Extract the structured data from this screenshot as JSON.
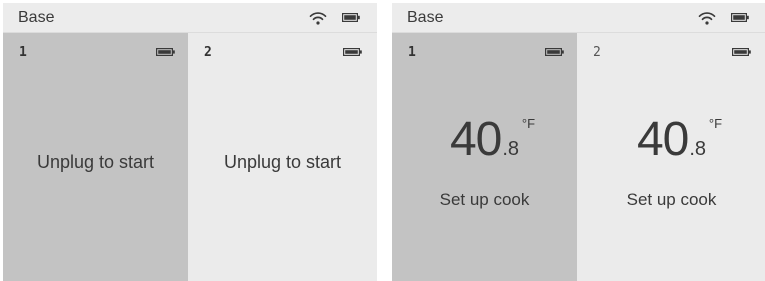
{
  "screens": [
    {
      "title": "Base",
      "status_icons": [
        "wifi-icon",
        "battery-icon"
      ],
      "probes": [
        {
          "number": "1",
          "battery_icon": "battery-icon",
          "selected": true,
          "message": "Unplug to start"
        },
        {
          "number": "2",
          "battery_icon": "battery-icon",
          "selected": false,
          "message": "Unplug to start"
        }
      ]
    },
    {
      "title": "Base",
      "status_icons": [
        "wifi-icon",
        "battery-icon"
      ],
      "probes": [
        {
          "number": "1",
          "battery_icon": "battery-icon",
          "selected": true,
          "temp_whole": "40",
          "temp_decimal": ".8",
          "temp_unit": "°F",
          "message": "Set up cook"
        },
        {
          "number": "2",
          "battery_icon": "battery-icon",
          "selected": false,
          "temp_whole": "40",
          "temp_decimal": ".8",
          "temp_unit": "°F",
          "message": "Set up cook"
        }
      ]
    }
  ],
  "colors": {
    "screen_background": "#ebebeb",
    "selected_panel": "#c3c3c3",
    "text": "#3a3a3a"
  }
}
